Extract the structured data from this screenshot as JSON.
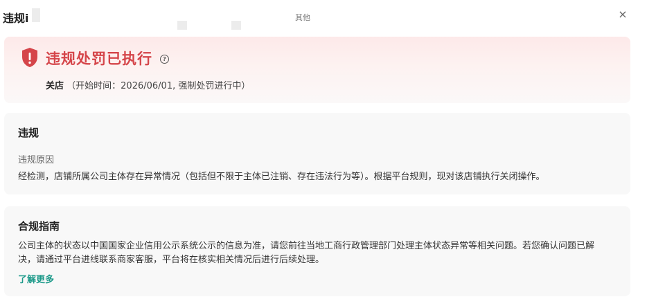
{
  "dialog": {
    "title": "违规i",
    "center_label": "其他",
    "close_label": "×"
  },
  "alert": {
    "title": "违规处罚已执行",
    "help_label": "?",
    "status_strong": "关店",
    "status_detail": "（开始时间：2026/06/01, 强制处罚进行中）",
    "accent_color": "#d5454a"
  },
  "violation": {
    "heading": "违规",
    "reason_label": "违规原因",
    "reason_text": "经检测，店铺所属公司主体存在异常情况（包括但不限于主体已注销、存在违法行为等）。根据平台规则，现对该店铺执行关闭操作。"
  },
  "guide": {
    "heading": "合规指南",
    "text_line1": "公司主体的状态以中国国家企业信用公示系统公示的信息为准，请您前往当地工商行政管理部门处理主体状态异常等相关问题。若您确认问题已解",
    "text_line2": "决，请通过平台进线联系商家客服，平台将在核实相关情况后进行后续处理。",
    "link_label": "了解更多",
    "link_color": "#1d9a8a"
  },
  "icons": {
    "shield": "shield-alert-icon",
    "help": "question-circle-icon",
    "close": "close-icon"
  }
}
